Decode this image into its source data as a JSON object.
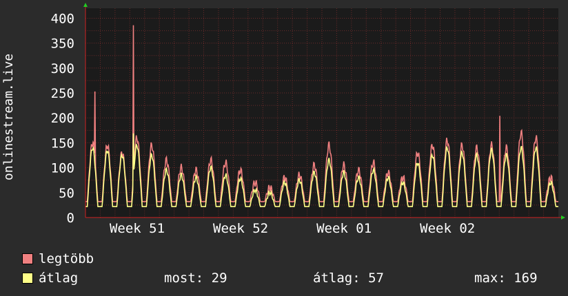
{
  "colors": {
    "background": "#2b2b2b",
    "plot_background": "#1b1b1b",
    "grid": "#6b2a2a",
    "axis": "#cc2222",
    "arrow": "#22cc22",
    "max_series": "#f08080",
    "avg_series": "#ffff88"
  },
  "legend": {
    "items": [
      {
        "label": "legtöbb",
        "color": "#f08080"
      },
      {
        "label": "átlag",
        "color": "#ffff88"
      }
    ],
    "now_label": "most:",
    "now_value": "29",
    "avg_label": "átlag:",
    "avg_value": "57",
    "max_label": "max:",
    "max_value": "169"
  },
  "chart_data": {
    "type": "line",
    "title": "",
    "xlabel": "",
    "ylabel": "onlinestream.live",
    "ylim": [
      0,
      420
    ],
    "yticks": [
      0,
      50,
      100,
      150,
      200,
      250,
      300,
      350,
      400
    ],
    "xticks": [
      "Week 51",
      "Week 52",
      "Week 01",
      "Week 02"
    ],
    "grid": true,
    "period_days": 32,
    "series": [
      {
        "name": "legtöbb",
        "color": "#f08080",
        "daily_peak": [
          150,
          145,
          130,
          160,
          145,
          115,
          100,
          95,
          115,
          110,
          95,
          70,
          60,
          80,
          85,
          105,
          145,
          105,
          95,
          110,
          90,
          80,
          130,
          145,
          155,
          145,
          140,
          145,
          140,
          170,
          160,
          80
        ],
        "spikes": [
          [
            0.65,
            253
          ],
          [
            3.25,
            386
          ],
          [
            28.05,
            204
          ]
        ]
      },
      {
        "name": "átlag",
        "color": "#ffff88",
        "daily_peak": [
          140,
          135,
          125,
          145,
          125,
          95,
          85,
          80,
          100,
          85,
          78,
          55,
          50,
          70,
          75,
          90,
          115,
          90,
          80,
          95,
          80,
          70,
          110,
          125,
          140,
          130,
          125,
          135,
          125,
          140,
          140,
          70
        ],
        "spikes": [
          [
            3.25,
            169
          ]
        ]
      }
    ]
  }
}
